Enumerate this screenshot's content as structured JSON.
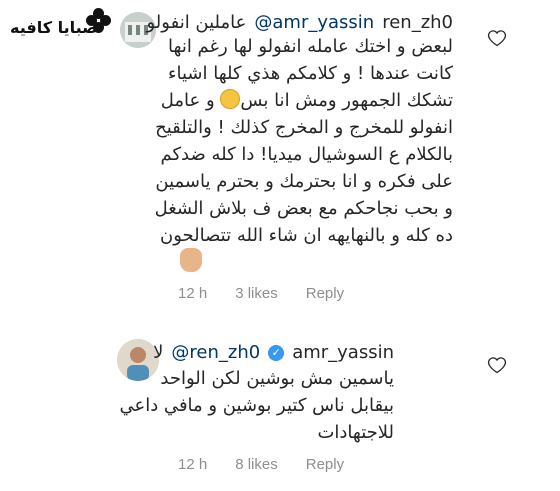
{
  "watermark": {
    "text": "صبايا كافيه"
  },
  "comments": [
    {
      "username": "ren_zh0",
      "mention": "@amr_yassin",
      "first_line": "عاملين انفولو",
      "lines": [
        "لبعض و اختك عامله انفولو لها رغم انها",
        "كانت عندها ! و كلامكم هذي كلها اشياء",
        "تشكك الجمهور ومش انا بس",
        "انفولو للمخرج و المخرج كذلك ! والتلقيح",
        "بالكلام ع السوشيال ميديا! دا كله ضدكم",
        "على فكره و انا بحترمك و بحترم ياسمين",
        "و بحب نجاحكم مع بعض ف بلاش الشغل",
        "ده كله و بالنهايهه ان شاء الله تتصالحون"
      ],
      "line3_suffix": "و عامل",
      "time": "12 h",
      "likes": "3 likes",
      "reply": "Reply"
    },
    {
      "username": "amr_yassin",
      "mention": "@ren_zh0",
      "first_line": "لا",
      "lines": [
        "ياسمين مش بوشين  لكن الواحد",
        "بيقابل ناس كتير بوشين  و مافي داعي",
        "للاجتهادات"
      ],
      "time": "12 h",
      "likes": "8 likes",
      "reply": "Reply"
    }
  ],
  "icons": {
    "like": "heart-outline-icon",
    "verified": "verified-badge-icon",
    "emoji_smile": "smiley-emoji",
    "emoji_hand": "raised-hand-emoji"
  }
}
